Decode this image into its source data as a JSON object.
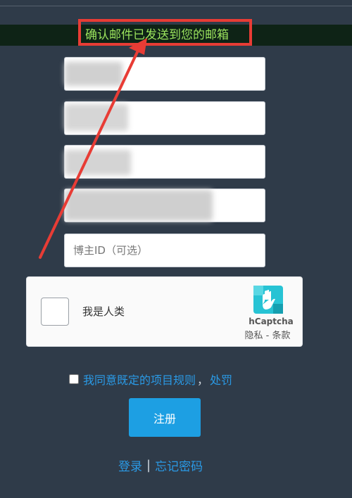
{
  "banner": {
    "message": "确认邮件已发送到您的邮箱"
  },
  "form": {
    "fields": [
      {
        "placeholder": ""
      },
      {
        "placeholder": ""
      },
      {
        "placeholder": ""
      },
      {
        "placeholder": ""
      },
      {
        "placeholder": "博主ID（可选）"
      }
    ]
  },
  "captcha": {
    "label": "我是人类",
    "brand": "hCaptcha",
    "privacy": "隐私",
    "separator": " - ",
    "terms": "条款"
  },
  "agreement": {
    "rules_link": "我同意既定的项目规则",
    "comma": "，",
    "penalty_link": "处罚"
  },
  "register": {
    "label": "注册"
  },
  "footer": {
    "login": "登录",
    "separator": "|",
    "forgot_password": "忘记密码"
  },
  "colors": {
    "background": "#2f3b49",
    "banner_bg": "#0e2316",
    "banner_text": "#9be35d",
    "annotation_red": "#e83c35",
    "accent_blue": "#1d9fe3"
  }
}
